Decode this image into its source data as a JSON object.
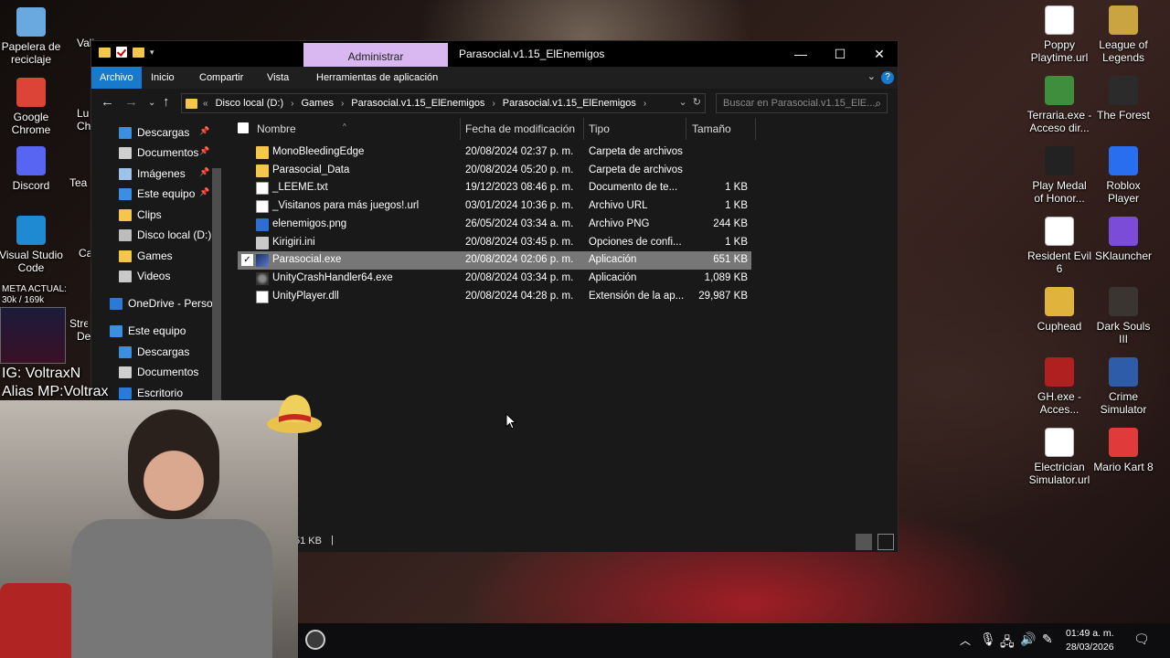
{
  "desktop": {
    "left_icons": [
      {
        "label": "Papelera de reciclaje",
        "icon": "recycle-bin-icon",
        "color": "#6aa9e0"
      },
      {
        "label": "Google Chrome",
        "icon": "chrome-icon",
        "color": "#db4437"
      },
      {
        "label": "Discord",
        "icon": "discord-icon",
        "color": "#5865f2"
      },
      {
        "label": "Visual Studio Code",
        "icon": "vscode-icon",
        "color": "#1f8ad2"
      }
    ],
    "partial_icons": [
      "Vali",
      "Lu",
      "Ch",
      "Tean",
      "Ca",
      "Stre",
      "De"
    ],
    "right_icons": [
      {
        "label": "Poppy Playtime.url",
        "icon": "url-file-icon",
        "color": "#ffffff"
      },
      {
        "label": "League of Legends",
        "icon": "lol-icon",
        "color": "#c9a441"
      },
      {
        "label": "Terraria.exe - Acceso dir...",
        "icon": "terraria-icon",
        "color": "#3e8e3e"
      },
      {
        "label": "The Forest",
        "icon": "forest-icon",
        "color": "#2b2b2b"
      },
      {
        "label": "Play Medal of Honor...",
        "icon": "medal-icon",
        "color": "#222222"
      },
      {
        "label": "Roblox Player",
        "icon": "roblox-icon",
        "color": "#2a6ef0"
      },
      {
        "label": "Resident Evil 6",
        "icon": "re6-icon",
        "color": "#ffffff"
      },
      {
        "label": "SKlauncher",
        "icon": "sklauncher-icon",
        "color": "#7a4cd8"
      },
      {
        "label": "Cuphead",
        "icon": "cuphead-icon",
        "color": "#e0b43c"
      },
      {
        "label": "Dark Souls III",
        "icon": "darksouls-icon",
        "color": "#3a3530"
      },
      {
        "label": "GH.exe - Acces...",
        "icon": "gh-icon",
        "color": "#b02020"
      },
      {
        "label": "Crime Simulator",
        "icon": "crime-sim-icon",
        "color": "#2f5ca8"
      },
      {
        "label": "Electrician Simulator.url",
        "icon": "url-file-icon",
        "color": "#ffffff"
      },
      {
        "label": "Mario Kart 8",
        "icon": "mariokart-icon",
        "color": "#e03a3a"
      }
    ]
  },
  "explorer": {
    "admin_tab": "Administrar",
    "title": "Parasocial.v1.15_ElEnemigos",
    "controls": {
      "minimize": "—",
      "maximize": "☐",
      "close": "✕"
    },
    "ribbon": {
      "file": "Archivo",
      "tabs": [
        "Inicio",
        "Compartir",
        "Vista",
        "Herramientas de aplicación"
      ]
    },
    "address": {
      "crumbs": [
        "Disco local (D:)",
        "Games",
        "Parasocial.v1.15_ElEnemigos",
        "Parasocial.v1.15_ElEnemigos"
      ],
      "lead": "«"
    },
    "search_placeholder": "Buscar en Parasocial.v1.15_ElE...",
    "nav": [
      {
        "label": "Descargas",
        "icon": "download-arrow-icon",
        "color": "#3c8ee0",
        "pinned": true
      },
      {
        "label": "Documentos",
        "icon": "documents-icon",
        "color": "#d0d0d0",
        "pinned": true
      },
      {
        "label": "Imágenes",
        "icon": "pictures-icon",
        "color": "#9fc3e8",
        "pinned": true
      },
      {
        "label": "Este equipo",
        "icon": "computer-icon",
        "color": "#3c8ee0",
        "pinned": true
      },
      {
        "label": "Clips",
        "icon": "folder-icon",
        "color": "#f4c64c",
        "pinned": false
      },
      {
        "label": "Disco local (D:)",
        "icon": "drive-icon",
        "color": "#bdbdbd",
        "pinned": false
      },
      {
        "label": "Games",
        "icon": "folder-icon",
        "color": "#f4c64c",
        "pinned": false
      },
      {
        "label": "Videos",
        "icon": "videos-icon",
        "color": "#c9c9c9",
        "pinned": false
      },
      {
        "label": "OneDrive - Person",
        "icon": "onedrive-icon",
        "color": "#2b7ad8",
        "pinned": false
      },
      {
        "label": "Este equipo",
        "icon": "computer-icon",
        "color": "#3c8ee0",
        "pinned": false
      },
      {
        "label": "Descargas",
        "icon": "download-arrow-icon",
        "color": "#3c8ee0",
        "pinned": false
      },
      {
        "label": "Documentos",
        "icon": "documents-icon",
        "color": "#d0d0d0",
        "pinned": false
      },
      {
        "label": "Escritorio",
        "icon": "desktop-icon",
        "color": "#2b7ad8",
        "pinned": false
      }
    ],
    "columns": {
      "name": "Nombre",
      "date": "Fecha de modificación",
      "type": "Tipo",
      "size": "Tamaño"
    },
    "files": [
      {
        "name": "MonoBleedingEdge",
        "date": "20/08/2024 02:37 p. m.",
        "type": "Carpeta de archivos",
        "size": "",
        "icon": "folder-icon",
        "selected": false
      },
      {
        "name": "Parasocial_Data",
        "date": "20/08/2024 05:20 p. m.",
        "type": "Carpeta de archivos",
        "size": "",
        "icon": "folder-icon",
        "selected": false
      },
      {
        "name": "_LEEME.txt",
        "date": "19/12/2023 08:46 p. m.",
        "type": "Documento de te...",
        "size": "1 KB",
        "icon": "text-file-icon",
        "selected": false
      },
      {
        "name": "_Visitanos para más juegos!.url",
        "date": "03/01/2024 10:36 p. m.",
        "type": "Archivo URL",
        "size": "1 KB",
        "icon": "url-file-icon",
        "selected": false
      },
      {
        "name": "elenemigos.png",
        "date": "26/05/2024 03:34 a. m.",
        "type": "Archivo PNG",
        "size": "244 KB",
        "icon": "image-file-icon",
        "selected": false
      },
      {
        "name": "Kirigiri.ini",
        "date": "20/08/2024 03:45 p. m.",
        "type": "Opciones de confi...",
        "size": "1 KB",
        "icon": "ini-file-icon",
        "selected": false
      },
      {
        "name": "Parasocial.exe",
        "date": "20/08/2024 02:06 p. m.",
        "type": "Aplicación",
        "size": "651 KB",
        "icon": "exe-file-icon",
        "selected": true
      },
      {
        "name": "UnityCrashHandler64.exe",
        "date": "20/08/2024 03:34 p. m.",
        "type": "Aplicación",
        "size": "1,089 KB",
        "icon": "crash-handler-icon",
        "selected": false
      },
      {
        "name": "UnityPlayer.dll",
        "date": "20/08/2024 04:28 p. m.",
        "type": "Extensión de la ap...",
        "size": "29,987 KB",
        "icon": "dll-file-icon",
        "selected": false
      }
    ],
    "status": "51 KB"
  },
  "overlay": {
    "meta": "META ACTUAL:",
    "meta_value": "30k / 169k",
    "ig": "IG: VoltraxN",
    "alias": "Alias MP:Voltrax"
  },
  "taskbar": {
    "time": "01:49 a. m.",
    "date": "28/03/2026"
  }
}
